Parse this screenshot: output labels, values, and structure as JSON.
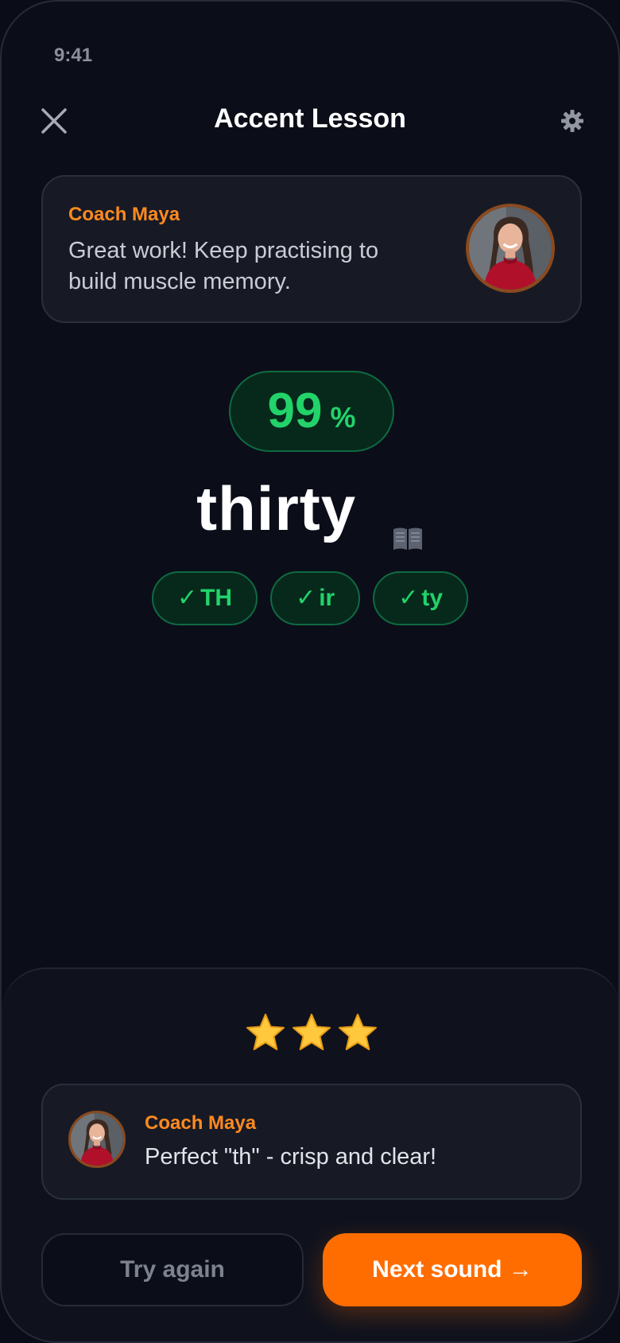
{
  "status_bar": {
    "time": "9:41"
  },
  "header": {
    "title": "Accent Lesson"
  },
  "coach_card": {
    "name": "Coach Maya",
    "message": "Great work! Keep practising to build muscle memory."
  },
  "score": {
    "value": "99",
    "unit": "%"
  },
  "word": {
    "text": "thirty"
  },
  "phonemes": [
    {
      "check": "✓",
      "label": "TH"
    },
    {
      "check": "✓",
      "label": "ir"
    },
    {
      "check": "✓",
      "label": "ty"
    }
  ],
  "rating": {
    "stars": 3,
    "max": 3
  },
  "feedback": {
    "name": "Coach Maya",
    "message": "Perfect \"th\" - crisp and clear!"
  },
  "actions": {
    "try_again": "Try again",
    "next_sound": "Next sound →"
  },
  "colors": {
    "accent": "#ff6d00",
    "coach_name": "#ff8a1f",
    "success": "#22d36a",
    "background": "#0b0e19"
  },
  "icons": [
    "close-icon",
    "gear-icon",
    "open-book-icon",
    "star-icon",
    "coach-avatar"
  ]
}
